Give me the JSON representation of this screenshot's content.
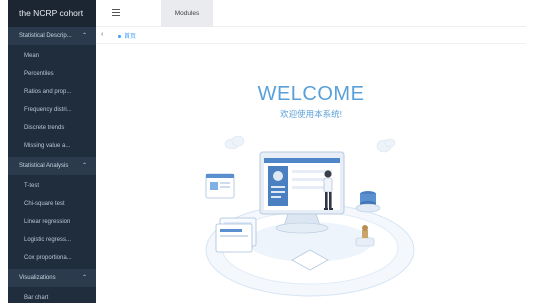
{
  "app": {
    "title": "the NCRP cohort"
  },
  "sidebar": {
    "sections": [
      {
        "label": "Statistical Descrip...",
        "items": [
          "Mean",
          "Percentiles",
          "Ratios and prop...",
          "Frequency distri...",
          "Discrete trends",
          "Missing value a..."
        ]
      },
      {
        "label": "Statistical Analysis",
        "items": [
          "T-test",
          "Chi-square test",
          "Linear regression",
          "Logistic regress...",
          "Cox proportiona..."
        ]
      },
      {
        "label": "Visualizations",
        "items": [
          "Bar chart"
        ]
      }
    ]
  },
  "topbar": {
    "menu_icon": "hamburger-icon",
    "tab_label": "Modules"
  },
  "breadcrumb": {
    "back_icon": "chevron-left-icon",
    "current": "首页"
  },
  "main": {
    "welcome_title": "WELCOME",
    "welcome_subtitle": "欢迎使用本系统!"
  },
  "colors": {
    "sidebar_bg": "#1f2d3d",
    "accent": "#409eff",
    "welcome": "#5aa0d8"
  }
}
